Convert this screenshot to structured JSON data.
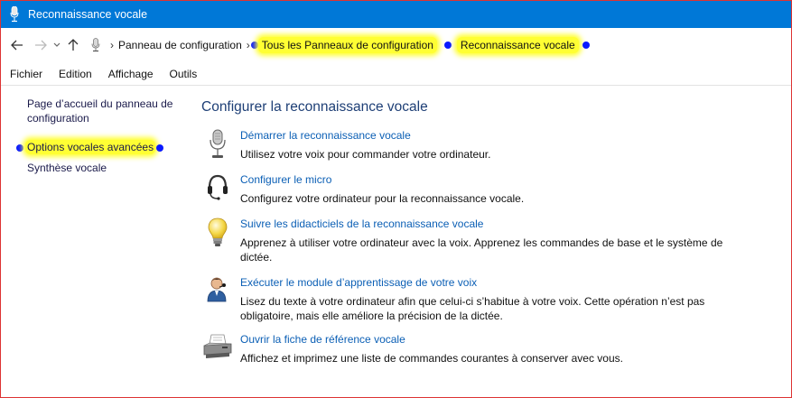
{
  "window": {
    "title": "Reconnaissance vocale",
    "icon": "microphone-icon"
  },
  "nav": {
    "back_icon": "back-arrow-icon",
    "forward_icon": "forward-arrow-icon",
    "recent_icon": "chevron-down-icon",
    "up_icon": "up-arrow-icon"
  },
  "breadcrumb": {
    "items": [
      "Panneau de configuration",
      "Tous les Panneaux de configuration",
      "Reconnaissance vocale"
    ],
    "separator": "›"
  },
  "menu": {
    "items": [
      "Fichier",
      "Edition",
      "Affichage",
      "Outils"
    ]
  },
  "sidebar": {
    "items": [
      {
        "label": "Page d’accueil du panneau de configuration"
      },
      {
        "label": "Options vocales avancées"
      },
      {
        "label": "Synthèse vocale"
      }
    ]
  },
  "main": {
    "title": "Configurer la reconnaissance vocale",
    "tasks": [
      {
        "icon": "microphone-icon",
        "link": "Démarrer la reconnaissance vocale",
        "desc": "Utilisez votre voix pour commander votre ordinateur."
      },
      {
        "icon": "headset-icon",
        "link": "Configurer le micro",
        "desc": "Configurez votre ordinateur pour la reconnaissance vocale."
      },
      {
        "icon": "lightbulb-icon",
        "link": "Suivre les didacticiels de la reconnaissance vocale",
        "desc": "Apprenez à utiliser votre ordinateur avec la voix. Apprenez les commandes de base et le système de dictée."
      },
      {
        "icon": "user-voice-icon",
        "link": "Exécuter le module d’apprentissage de votre voix",
        "desc": "Lisez du texte à votre ordinateur afin que celui-ci s’habitue à votre voix. Cette opération n’est pas obligatoire, mais elle améliore la précision de la dictée."
      },
      {
        "icon": "printer-icon",
        "link": "Ouvrir la fiche de référence vocale",
        "desc": "Affichez et imprimez une liste de commandes courantes à conserver avec vous."
      }
    ]
  },
  "colors": {
    "titlebar": "#0078d7",
    "link": "#0b5fb5",
    "heading": "#1e3f76",
    "highlight": "#ffff33",
    "annotation_dot": "#0a1aff"
  }
}
